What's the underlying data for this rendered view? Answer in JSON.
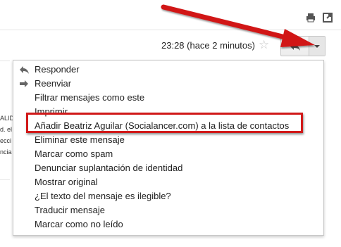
{
  "header": {
    "timestamp": "23:28 (hace 2 minutos)",
    "left_snippets": [
      "ALIDA",
      "d. el",
      "ecci",
      "ncia"
    ]
  },
  "icons": {
    "print": "print-icon",
    "popout": "popout-icon",
    "star": "star-icon",
    "reply": "reply-icon",
    "caret": "chevron-down-icon"
  },
  "menu": {
    "items": [
      {
        "label": "Responder",
        "icon": "reply-icon"
      },
      {
        "label": "Reenviar",
        "icon": "forward-icon"
      },
      {
        "label": "Filtrar mensajes como este"
      },
      {
        "label": "Imprimir"
      },
      {
        "label": "Añadir Beatriz Aguilar (Socialancer.com) a la lista de contactos"
      },
      {
        "label": "Eliminar este mensaje"
      },
      {
        "label": "Marcar como spam"
      },
      {
        "label": "Denunciar suplantación de identidad"
      },
      {
        "label": "Mostrar original"
      },
      {
        "label": "¿El texto del mensaje es ilegible?"
      },
      {
        "label": "Traducir mensaje"
      },
      {
        "label": "Marcar como no leído"
      }
    ]
  },
  "colors": {
    "annotation_red": "#d11919",
    "menu_border": "#c8c8c8"
  }
}
